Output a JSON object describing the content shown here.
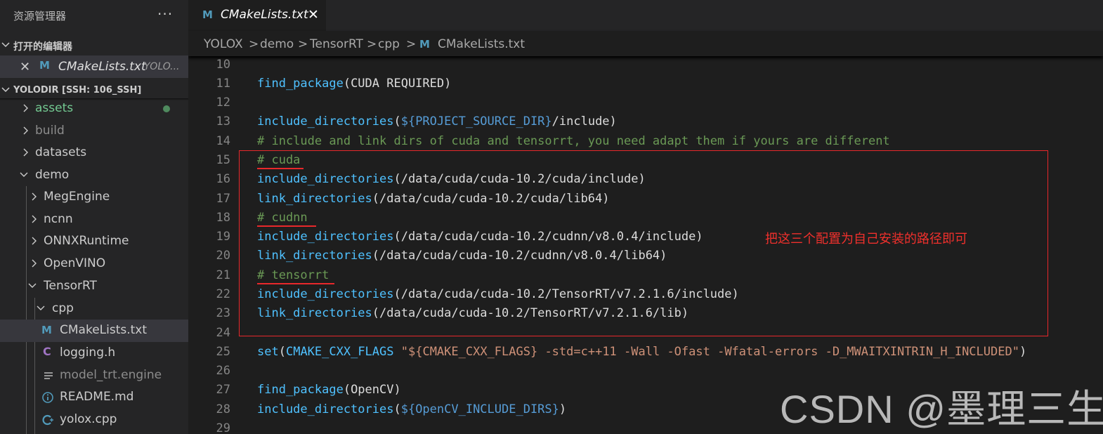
{
  "sidebar": {
    "title": "资源管理器",
    "more": "···",
    "open_editors": {
      "header": "打开的编辑器",
      "item_name": "CMakeLists.txt",
      "item_desc": "YOLO..."
    },
    "workspace": {
      "header": "YOLODIR [SSH: 106_SSH]"
    },
    "tree": [
      {
        "label": "assets",
        "kind": "folder",
        "state": "collapsed"
      },
      {
        "label": "build",
        "kind": "folder",
        "state": "collapsed"
      },
      {
        "label": "datasets",
        "kind": "folder",
        "state": "collapsed"
      },
      {
        "label": "demo",
        "kind": "folder",
        "state": "expanded"
      },
      {
        "label": "MegEngine",
        "kind": "folder",
        "state": "collapsed"
      },
      {
        "label": "ncnn",
        "kind": "folder",
        "state": "collapsed"
      },
      {
        "label": "ONNXRuntime",
        "kind": "folder",
        "state": "collapsed"
      },
      {
        "label": "OpenVINO",
        "kind": "folder",
        "state": "collapsed"
      },
      {
        "label": "TensorRT",
        "kind": "folder",
        "state": "expanded"
      },
      {
        "label": "cpp",
        "kind": "folder",
        "state": "expanded"
      },
      {
        "label": "CMakeLists.txt",
        "kind": "file",
        "icon": "m-icon"
      },
      {
        "label": "logging.h",
        "kind": "file",
        "icon": "c-icon"
      },
      {
        "label": "model_trt.engine",
        "kind": "file",
        "icon": "lines-icon"
      },
      {
        "label": "README.md",
        "kind": "file",
        "icon": "info-icon"
      },
      {
        "label": "yolox.cpp",
        "kind": "file",
        "icon": "cpp-icon"
      }
    ]
  },
  "tab": {
    "name": "CMakeLists.txt",
    "close": "✕",
    "icon_letter": "M"
  },
  "breadcrumb": [
    "YOLOX",
    "demo",
    "TensorRT",
    "cpp",
    "CMakeLists.txt"
  ],
  "editor": {
    "line_numbers": [
      "10",
      "11",
      "12",
      "13",
      "14",
      "15",
      "16",
      "17",
      "18",
      "19",
      "20",
      "21",
      "22",
      "23",
      "24",
      "25",
      "26",
      "27",
      "28",
      "29"
    ],
    "lines": {
      "l11": {
        "fn": "find_package",
        "rest": "(CUDA REQUIRED)"
      },
      "l13": {
        "fn": "include_directories",
        "open": "(",
        "var": "${PROJECT_SOURCE_DIR}",
        "rest": "/include)"
      },
      "l14": {
        "comment": "# include and link dirs of cuda and tensorrt, you need adapt them if yours are different"
      },
      "l15": {
        "comment": "# cuda"
      },
      "l16": {
        "fn": "include_directories",
        "rest": "(/data/cuda/cuda-10.2/cuda/include)"
      },
      "l17": {
        "fn": "link_directories",
        "rest": "(/data/cuda/cuda-10.2/cuda/lib64)"
      },
      "l18": {
        "comment": "# cudnn"
      },
      "l19": {
        "fn": "include_directories",
        "rest": "(/data/cuda/cuda-10.2/cudnn/v8.0.4/include)"
      },
      "l20": {
        "fn": "link_directories",
        "rest": "(/data/cuda/cuda-10.2/cudnn/v8.0.4/lib64)"
      },
      "l21": {
        "comment": "# tensorrt"
      },
      "l22": {
        "fn": "include_directories",
        "rest": "(/data/cuda/cuda-10.2/TensorRT/v7.2.1.6/include)"
      },
      "l23": {
        "fn": "link_directories",
        "rest": "(/data/cuda/cuda-10.2/TensorRT/v7.2.1.6/lib)"
      },
      "l25": {
        "fn": "set",
        "open": "(",
        "id": "CMAKE_CXX_FLAGS",
        "str": "\"${CMAKE_CXX_FLAGS} -std=c++11 -Wall -Ofast -Wfatal-errors -D_MWAITXINTRIN_H_INCLUDED\"",
        "close": ")"
      },
      "l27": {
        "fn": "find_package",
        "rest": "(OpenCV)"
      },
      "l28": {
        "fn": "include_directories",
        "open": "(",
        "var": "${OpenCV_INCLUDE_DIRS}",
        "close": ")"
      }
    }
  },
  "annotation": "把这三个配置为自己安装的路径即可",
  "watermark": "CSDN @墨理三生",
  "colors": {
    "accent_red": "#e8282b",
    "function_blue": "#4fc1ff",
    "comment_green": "#6a9955",
    "string_orange": "#ce9178"
  }
}
